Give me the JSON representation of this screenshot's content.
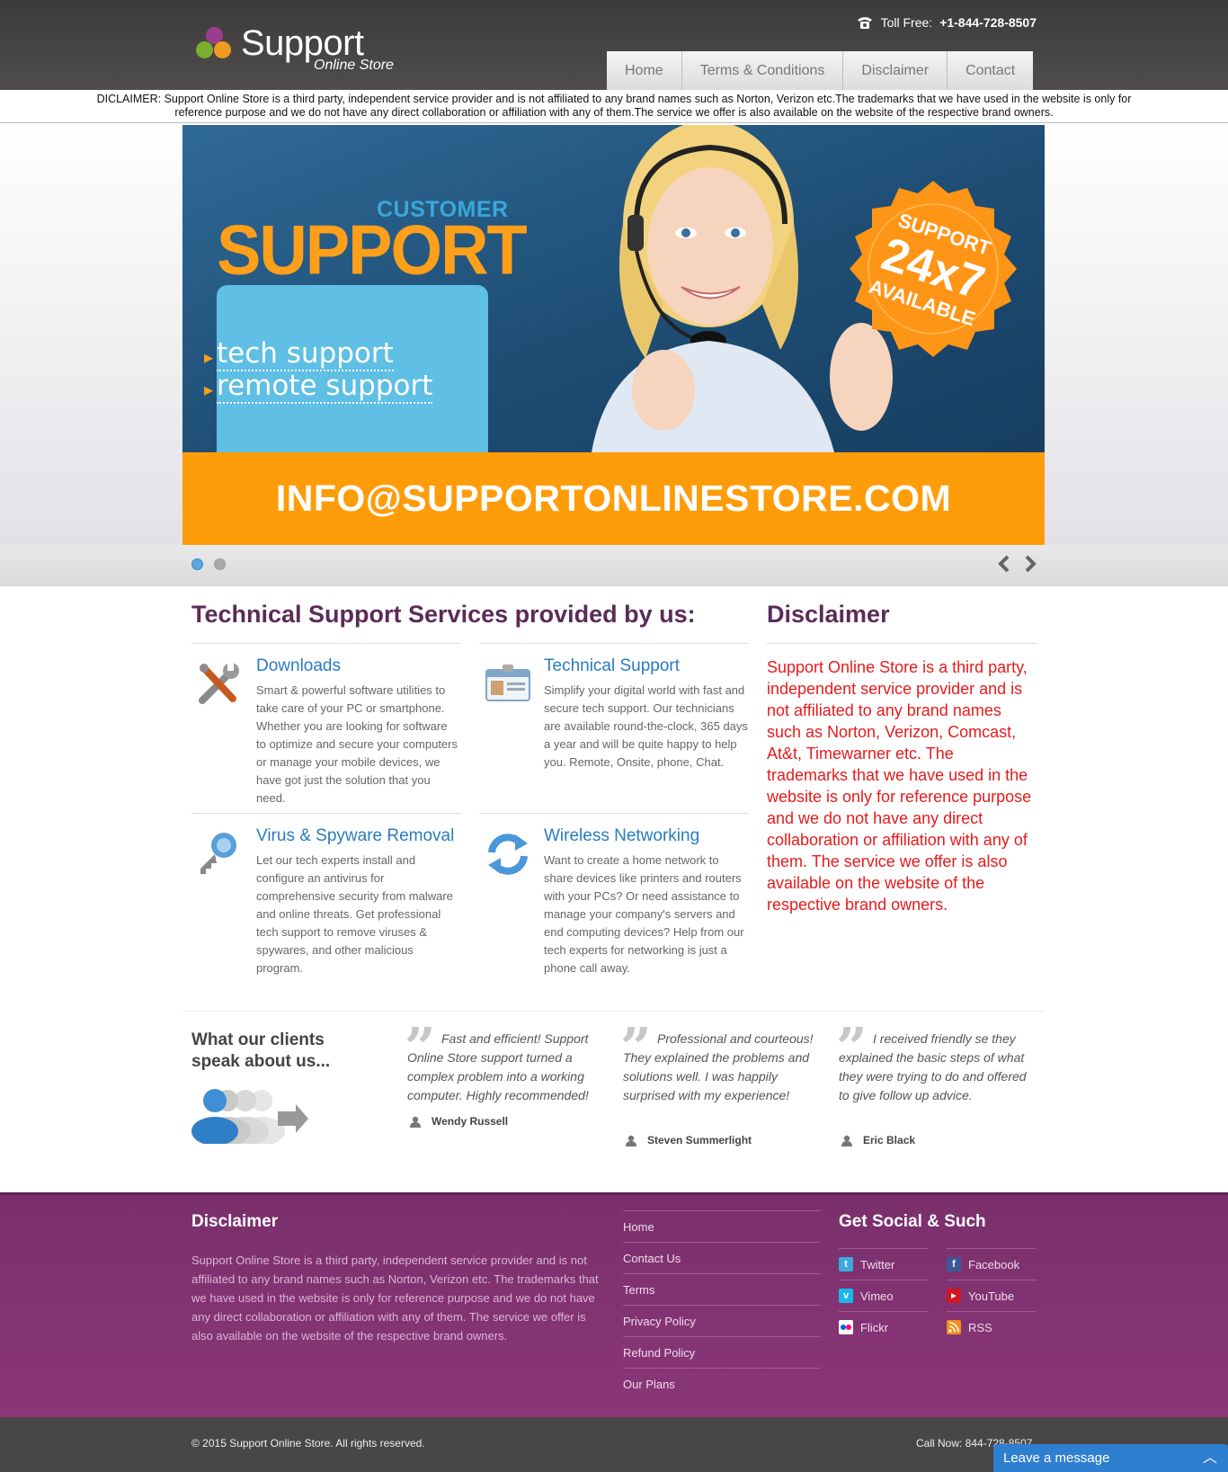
{
  "header": {
    "brand": "Support",
    "brand_sub": "Online Store",
    "tollfree_label": "Toll Free:",
    "tollfree_number": "+1-844-728-8507",
    "nav": [
      "Home",
      "Terms & Conditions",
      "Disclaimer",
      "Contact"
    ]
  },
  "disclaimer_strip": "DICLAIMER: Support Online Store is a third party, independent service provider and is not affiliated to any brand names such as Norton, Verizon etc.The trademarks that we have used in the website is only for reference purpose and we do not have any direct collaboration or affiliation with any of them.The service we offer is also available on the website of the respective brand owners.",
  "banner": {
    "customer": "CUSTOMER",
    "support": "SUPPORT",
    "items": [
      "tech support",
      "remote support"
    ],
    "badge_line1": "SUPPORT",
    "badge_line2": "24x7",
    "badge_line3": "AVAILABLE",
    "email": "INFO@SUPPORTONLINESTORE.COM",
    "active_slide": 1,
    "slide_count": 2
  },
  "services": {
    "title": "Technical Support Services provided by us:",
    "items": [
      {
        "title": "Downloads",
        "icon": "tools-icon",
        "text": "Smart & powerful software utilities to take care of your PC or smartphone. Whether you are looking for software to optimize and secure your computers or manage your mobile devices, we have got just the solution that you need."
      },
      {
        "title": "Technical Support",
        "icon": "id-card-icon",
        "text": "Simplify your digital world with fast and secure tech support. Our technicians are available round-the-clock, 365 days a year and will be quite happy to help you. Remote, Onsite, phone, Chat."
      },
      {
        "title": "Virus & Spyware Removal",
        "icon": "key-icon",
        "text": "Let our tech experts install and configure an antivirus for comprehensive security from malware and online threats. Get professional tech support to remove viruses & spywares, and other malicious program."
      },
      {
        "title": "Wireless Networking",
        "icon": "sync-icon",
        "text": "Want to create a home network to share devices like printers and routers with your PCs? Or need assistance to manage your company's servers and end computing devices? Help from our tech experts for networking is just a phone call away."
      }
    ]
  },
  "disclaimer": {
    "title": "Disclaimer",
    "text": "Support Online Store is a third party, independent service provider and is not affiliated to any brand names such as Norton, Verizon, Comcast, At&t, Timewarner etc. The trademarks that we have used in the website is only for reference purpose and we do not have any direct collaboration or affiliation with any of them. The service we offer is also available on the website of the respective brand owners."
  },
  "clients": {
    "title": "What our clients speak about us...",
    "testimonials": [
      {
        "quote": "Fast and efficient! Support Online Store support turned a complex problem into a working computer. Highly recommended!",
        "author": "Wendy Russell"
      },
      {
        "quote": "Professional and courteous! They explained the problems and solutions well. I was happily surprised with my experience!",
        "author": "Steven Summerlight"
      },
      {
        "quote": "I received friendly se they explained the basic steps of what they were trying to do and offered to give follow up advice.",
        "author": "Eric Black"
      }
    ]
  },
  "footer": {
    "disclaimer_title": "Disclaimer",
    "disclaimer_text": "Support Online Store is a third party, independent service provider and is not affiliated to any brand names such as Norton, Verizon etc. The trademarks that we have used in the website is only for reference purpose and we do not have any direct collaboration or affiliation with any of them. The service we offer is also available on the website of the respective brand owners.",
    "links": [
      "Home",
      "Contact Us",
      "Terms",
      "Privacy Policy",
      "Refund Policy",
      "Our Plans"
    ],
    "social_title": "Get Social & Such",
    "social": [
      {
        "label": "Twitter",
        "icon": "twitter-icon",
        "color": "#3ba9e0"
      },
      {
        "label": "Facebook",
        "icon": "facebook-icon",
        "color": "#3b5998"
      },
      {
        "label": "Vimeo",
        "icon": "vimeo-icon",
        "color": "#1ab7ea"
      },
      {
        "label": "YouTube",
        "icon": "youtube-icon",
        "color": "#cc181e"
      },
      {
        "label": "Flickr",
        "icon": "flickr-icon",
        "color": "#ffffff"
      },
      {
        "label": "RSS",
        "icon": "rss-icon",
        "color": "#f39019"
      }
    ],
    "copyright": "© 2015 Support Online Store. All rights reserved.",
    "call_now": "Call Now: 844-728-8507"
  },
  "chat": {
    "label": "Leave a message"
  },
  "colors": {
    "accent_orange": "#ff9c0a",
    "footer_purple": "#7a2f6c",
    "link_blue": "#2a7bbf",
    "disclaimer_red": "#e61b1b"
  }
}
